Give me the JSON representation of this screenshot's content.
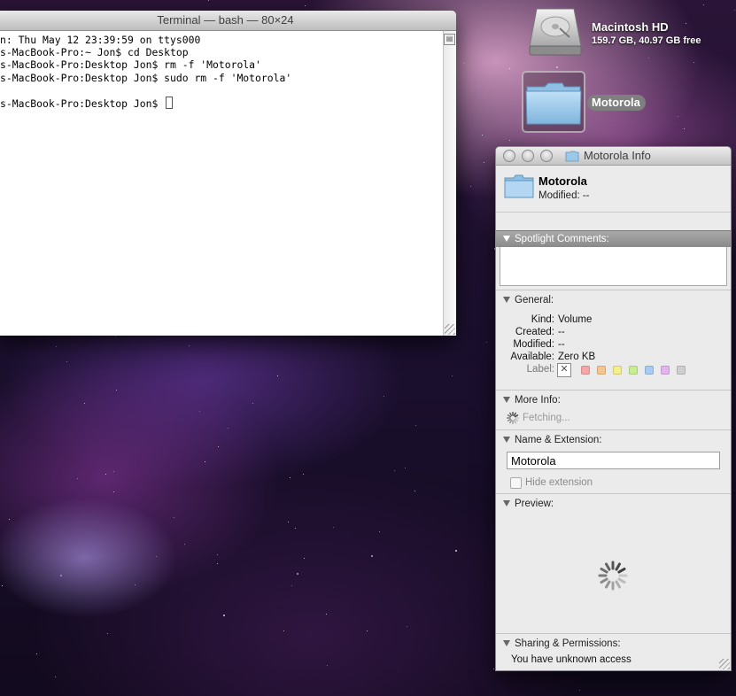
{
  "terminal": {
    "title": "Terminal — bash — 80×24",
    "lines": [
      "n: Thu May 12 23:39:59 on ttys000",
      "s-MacBook-Pro:~ Jon$ cd Desktop",
      "s-MacBook-Pro:Desktop Jon$ rm -f 'Motorola'",
      "s-MacBook-Pro:Desktop Jon$ sudo rm -f 'Motorola'",
      "",
      "s-MacBook-Pro:Desktop Jon$ "
    ]
  },
  "desktop": {
    "hd_name": "Macintosh HD",
    "hd_info": "159.7 GB, 40.97 GB free",
    "folder_name": "Motorola"
  },
  "info_window": {
    "title": "Motorola Info",
    "name": "Motorola",
    "modified": "Modified: --",
    "spotlight": {
      "heading": "Spotlight Comments:",
      "value": ""
    },
    "general": {
      "heading": "General:",
      "kind_label": "Kind:",
      "kind": "Volume",
      "created_label": "Created:",
      "created": "--",
      "modified_label": "Modified:",
      "modified": "--",
      "available_label": "Available:",
      "available": "Zero KB",
      "label_label": "Label:",
      "label_colors": [
        "#f6a6a6",
        "#f7c58e",
        "#f4ef8a",
        "#c8ee92",
        "#a6ccf4",
        "#e4b4ee",
        "#cfcfcf"
      ]
    },
    "more_info": {
      "heading": "More Info:",
      "status": "Fetching..."
    },
    "name_ext": {
      "heading": "Name & Extension:",
      "value": "Motorola",
      "hide_extension": "Hide extension"
    },
    "preview": {
      "heading": "Preview:"
    },
    "sharing": {
      "heading": "Sharing & Permissions:",
      "access": "You have unknown access"
    }
  }
}
